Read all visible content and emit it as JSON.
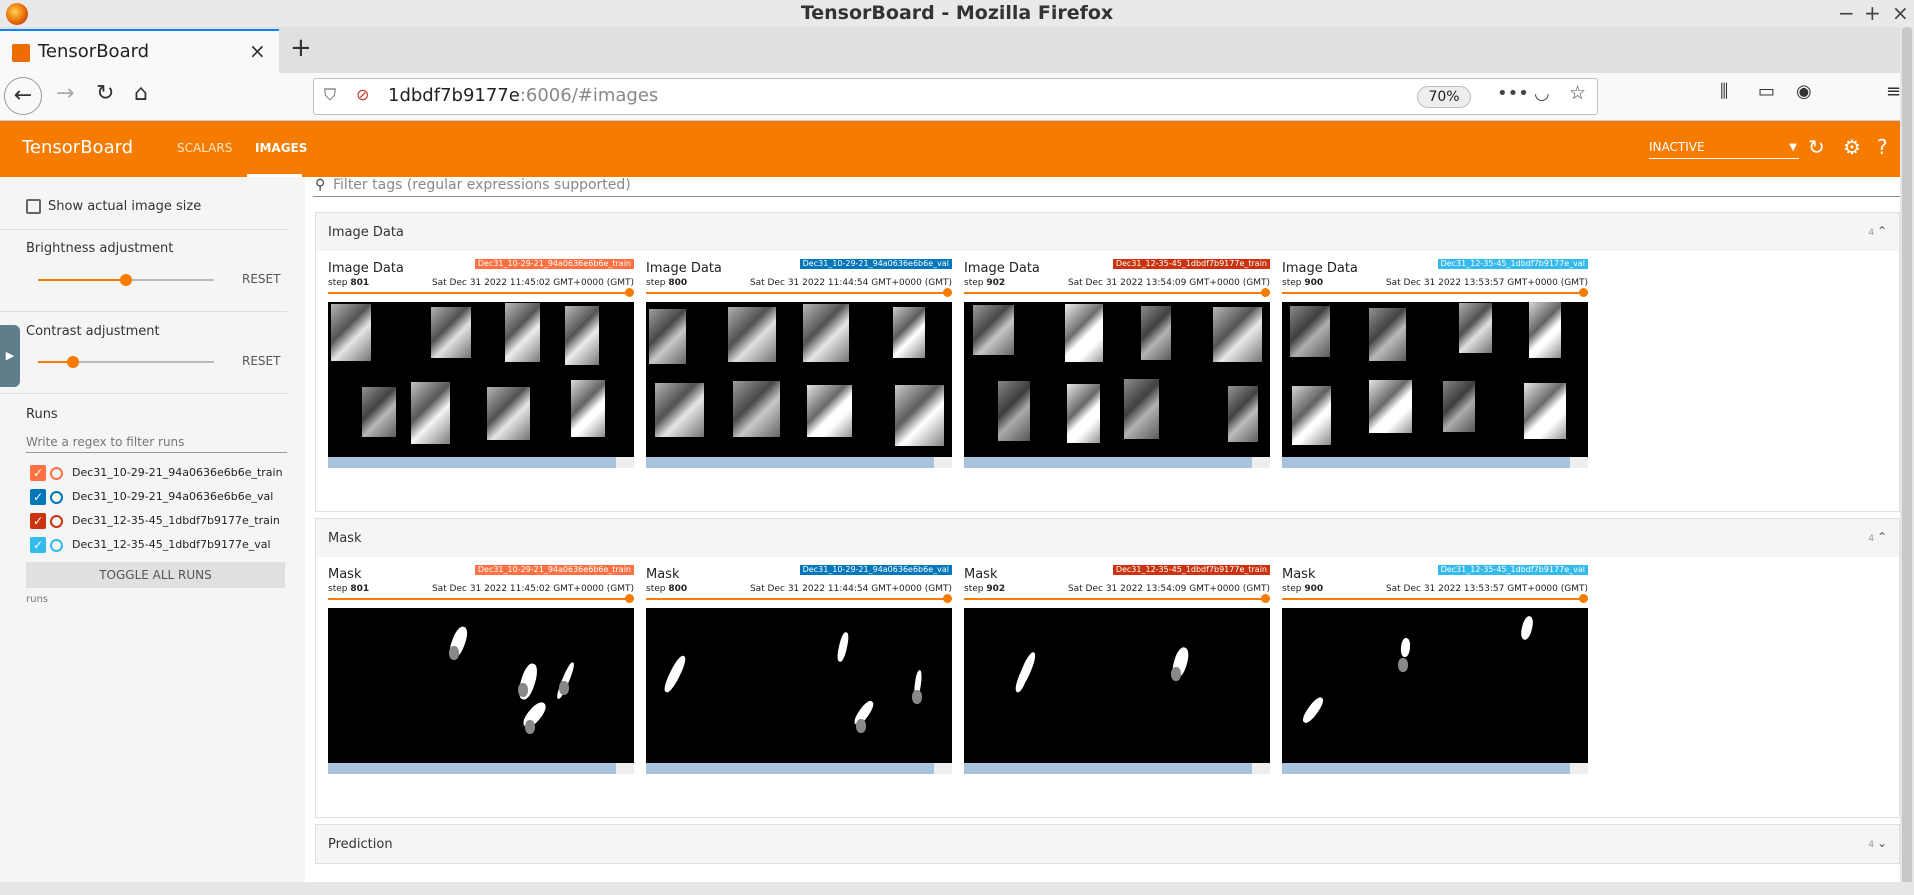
{
  "window": {
    "title": "TensorBoard - Mozilla Firefox",
    "controls": [
      "−",
      "+",
      "×"
    ]
  },
  "browser": {
    "tab_title": "TensorBoard",
    "tab_close": "×",
    "new_tab": "+",
    "url_host": "1dbdf7b9177e",
    "url_rest": ":6006/#images",
    "zoom": "70%"
  },
  "toolbar": {
    "brand": "TensorBoard",
    "tabs": [
      "SCALARS",
      "IMAGES"
    ],
    "run_selector": "INACTIVE"
  },
  "sidebar": {
    "show_actual_size": "Show actual image size",
    "brightness_label": "Brightness adjustment",
    "brightness_value": 0.5,
    "contrast_label": "Contrast adjustment",
    "contrast_value": 0.2,
    "reset": "RESET",
    "runs_title": "Runs",
    "runs_filter_placeholder": "Write a regex to filter runs",
    "runs": [
      {
        "name": "Dec31_10-29-21_94a0636e6b6e_train",
        "color": "#ff7043",
        "checked": true
      },
      {
        "name": "Dec31_10-29-21_94a0636e6b6e_val",
        "color": "#0077bb",
        "checked": true
      },
      {
        "name": "Dec31_12-35-45_1dbdf7b9177e_train",
        "color": "#cc3311",
        "checked": true
      },
      {
        "name": "Dec31_12-35-45_1dbdf7b9177e_val",
        "color": "#33bbee",
        "checked": true
      }
    ],
    "toggle_all": "TOGGLE ALL RUNS",
    "runs_footer": "runs"
  },
  "main": {
    "filter_placeholder": "Filter tags (regular expressions supported)",
    "sections": [
      {
        "title": "Image Data",
        "count": "4",
        "cards": [
          {
            "tag": "Image Data",
            "step_label": "step",
            "step": "801",
            "date": "Sat Dec 31 2022 11:45:02 GMT+0000 (GMT)",
            "run": "Dec31_10-29-21_94a0636e6b6e_train"
          },
          {
            "tag": "Image Data",
            "step_label": "step",
            "step": "800",
            "date": "Sat Dec 31 2022 11:44:54 GMT+0000 (GMT)",
            "run": "Dec31_10-29-21_94a0636e6b6e_val"
          },
          {
            "tag": "Image Data",
            "step_label": "step",
            "step": "902",
            "date": "Sat Dec 31 2022 13:54:09 GMT+0000 (GMT)",
            "run": "Dec31_12-35-45_1dbdf7b9177e_train"
          },
          {
            "tag": "Image Data",
            "step_label": "step",
            "step": "900",
            "date": "Sat Dec 31 2022 13:53:57 GMT+0000 (GMT)",
            "run": "Dec31_12-35-45_1dbdf7b9177e_val"
          }
        ]
      },
      {
        "title": "Mask",
        "count": "4",
        "cards": [
          {
            "tag": "Mask",
            "step_label": "step",
            "step": "801",
            "date": "Sat Dec 31 2022 11:45:02 GMT+0000 (GMT)",
            "run": "Dec31_10-29-21_94a0636e6b6e_train"
          },
          {
            "tag": "Mask",
            "step_label": "step",
            "step": "800",
            "date": "Sat Dec 31 2022 11:44:54 GMT+0000 (GMT)",
            "run": "Dec31_10-29-21_94a0636e6b6e_val"
          },
          {
            "tag": "Mask",
            "step_label": "step",
            "step": "902",
            "date": "Sat Dec 31 2022 13:54:09 GMT+0000 (GMT)",
            "run": "Dec31_12-35-45_1dbdf7b9177e_train"
          },
          {
            "tag": "Mask",
            "step_label": "step",
            "step": "900",
            "date": "Sat Dec 31 2022 13:53:57 GMT+0000 (GMT)",
            "run": "Dec31_12-35-45_1dbdf7b9177e_val"
          }
        ]
      },
      {
        "title": "Prediction",
        "count": "4"
      }
    ]
  },
  "colors": {
    "accent": "#f57c00",
    "train_a": "#ff7043",
    "val_a": "#0077bb",
    "train_b": "#cc3311",
    "val_b": "#33bbee"
  }
}
